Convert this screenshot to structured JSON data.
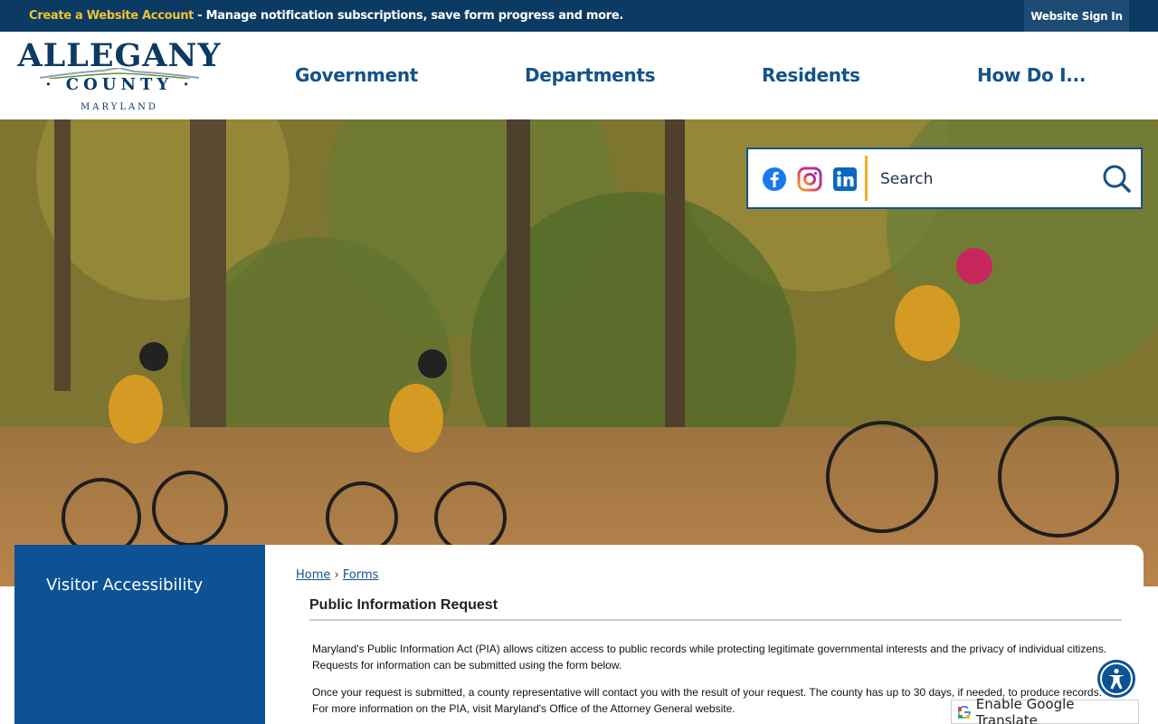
{
  "topbar": {
    "create_account": "Create a Website Account",
    "message": " - Manage notification subscriptions, save form progress and more.",
    "sign_in": "Website Sign In"
  },
  "logo": {
    "main": "ALLEGANY",
    "county": "· COUNTY ·",
    "state": "MARYLAND"
  },
  "nav": {
    "government": "Government",
    "departments": "Departments",
    "residents": "Residents",
    "how_do_i": "How Do I..."
  },
  "social": {
    "facebook": "facebook-icon",
    "instagram": "instagram-icon",
    "linkedin": "linkedin-icon"
  },
  "search": {
    "placeholder": "Search"
  },
  "sidebar": {
    "title": "Visitor Accessibility"
  },
  "breadcrumb": {
    "home": "Home",
    "separator": "›",
    "forms": "Forms"
  },
  "page": {
    "title": "Public Information Request",
    "para1": "Maryland's Public Information Act (PIA) allows citizen access to public records while protecting legitimate governmental interests and the privacy of individual citizens. Requests for information can be submitted using the form below.",
    "para2": "Once your request is submitted, a county representative will contact you with the result of your request. The county has up to 30 days, if needed, to produce records. For more information on the PIA, visit Maryland's Office of the Attorney General website."
  },
  "translate": {
    "label": "Enable Google Translate"
  },
  "colors": {
    "brand_navy": "#0b3a63",
    "nav_blue": "#155289",
    "accent_gold": "#f2c230",
    "sidebar_blue": "#0c5294"
  }
}
